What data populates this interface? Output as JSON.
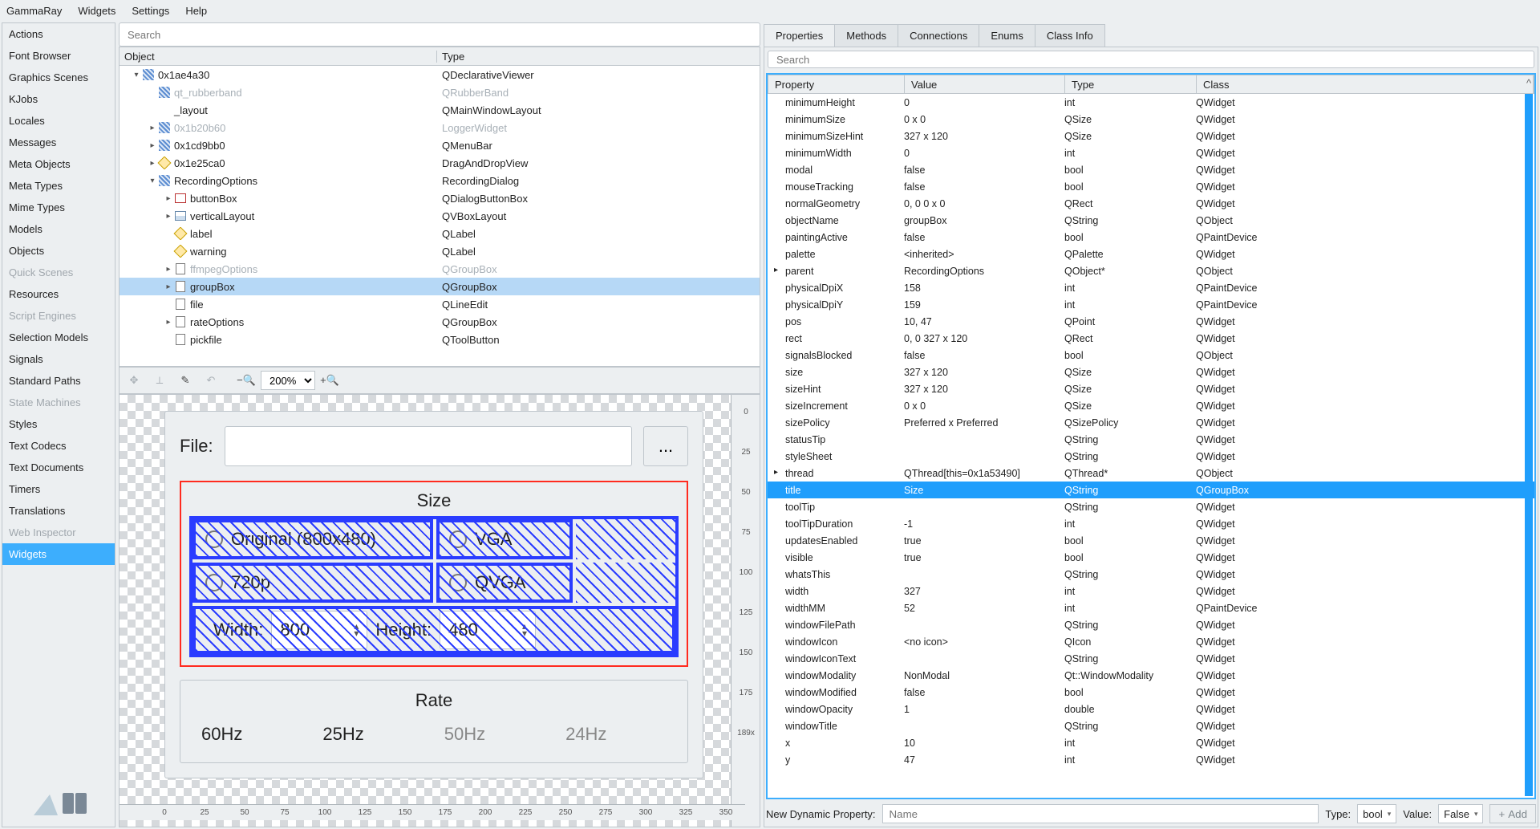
{
  "menubar": [
    "GammaRay",
    "Widgets",
    "Settings",
    "Help"
  ],
  "tool_list": [
    {
      "label": "Actions"
    },
    {
      "label": "Font Browser"
    },
    {
      "label": "Graphics Scenes"
    },
    {
      "label": "KJobs"
    },
    {
      "label": "Locales"
    },
    {
      "label": "Messages"
    },
    {
      "label": "Meta Objects"
    },
    {
      "label": "Meta Types"
    },
    {
      "label": "Mime Types"
    },
    {
      "label": "Models"
    },
    {
      "label": "Objects"
    },
    {
      "label": "Quick Scenes",
      "disabled": true
    },
    {
      "label": "Resources"
    },
    {
      "label": "Script Engines",
      "disabled": true
    },
    {
      "label": "Selection Models"
    },
    {
      "label": "Signals"
    },
    {
      "label": "Standard Paths"
    },
    {
      "label": "State Machines",
      "disabled": true
    },
    {
      "label": "Styles"
    },
    {
      "label": "Text Codecs"
    },
    {
      "label": "Text Documents"
    },
    {
      "label": "Timers"
    },
    {
      "label": "Translations"
    },
    {
      "label": "Web Inspector",
      "disabled": true
    },
    {
      "label": "Widgets",
      "selected": true
    }
  ],
  "obj_search_placeholder": "Search",
  "obj_headers": {
    "object": "Object",
    "type": "Type"
  },
  "obj_tree": [
    {
      "indent": 0,
      "twisty": "▾",
      "icon": "hatch",
      "name": "0x1ae4a30",
      "type": "QDeclarativeViewer"
    },
    {
      "indent": 1,
      "twisty": "",
      "icon": "hatch",
      "name": "qt_rubberband",
      "type": "QRubberBand",
      "disabled": true
    },
    {
      "indent": 1,
      "twisty": "",
      "icon": "",
      "name": "_layout",
      "type": "QMainWindowLayout"
    },
    {
      "indent": 1,
      "twisty": "▸",
      "icon": "hatch",
      "name": "0x1b20b60",
      "type": "LoggerWidget",
      "disabled": true
    },
    {
      "indent": 1,
      "twisty": "▸",
      "icon": "hatch",
      "name": "0x1cd9bb0",
      "type": "QMenuBar"
    },
    {
      "indent": 1,
      "twisty": "▸",
      "icon": "tag",
      "name": "0x1e25ca0",
      "type": "DragAndDropView"
    },
    {
      "indent": 1,
      "twisty": "▾",
      "icon": "hatch",
      "name": "RecordingOptions",
      "type": "RecordingDialog"
    },
    {
      "indent": 2,
      "twisty": "▸",
      "icon": "box",
      "name": "buttonBox",
      "type": "QDialogButtonBox"
    },
    {
      "indent": 2,
      "twisty": "▸",
      "icon": "layout",
      "name": "verticalLayout",
      "type": "QVBoxLayout"
    },
    {
      "indent": 2,
      "twisty": "",
      "icon": "tag",
      "name": "label",
      "type": "QLabel"
    },
    {
      "indent": 2,
      "twisty": "",
      "icon": "tag",
      "name": "warning",
      "type": "QLabel"
    },
    {
      "indent": 2,
      "twisty": "▸",
      "icon": "page",
      "name": "ffmpegOptions",
      "type": "QGroupBox",
      "disabled": true
    },
    {
      "indent": 2,
      "twisty": "▸",
      "icon": "page",
      "name": "groupBox",
      "type": "QGroupBox",
      "selected": true
    },
    {
      "indent": 2,
      "twisty": "",
      "icon": "page",
      "name": "file",
      "type": "QLineEdit"
    },
    {
      "indent": 2,
      "twisty": "▸",
      "icon": "page",
      "name": "rateOptions",
      "type": "QGroupBox"
    },
    {
      "indent": 2,
      "twisty": "",
      "icon": "page",
      "name": "pickfile",
      "type": "QToolButton"
    }
  ],
  "toolbar": {
    "zoom": "200%"
  },
  "preview": {
    "file_label": "File:",
    "browse": "...",
    "size_group": {
      "title": "Size",
      "opt_original": "Original (800x480)",
      "opt_vga": "VGA",
      "opt_720p": "720p",
      "opt_qvga": "QVGA",
      "width_label": "Width:",
      "height_label": "Height:",
      "width_val": "800",
      "height_val": "480"
    },
    "rate_group": {
      "title": "Rate",
      "opts": [
        "60Hz",
        "25Hz",
        "50Hz",
        "24Hz"
      ]
    },
    "ruler_x": [
      "0",
      "25",
      "50",
      "75",
      "100",
      "125",
      "150",
      "175",
      "200",
      "225",
      "250",
      "275",
      "300",
      "325",
      "350"
    ],
    "ruler_y": [
      "0",
      "25",
      "50",
      "75",
      "100",
      "125",
      "150",
      "175",
      "189x"
    ]
  },
  "right_tabs": [
    "Properties",
    "Methods",
    "Connections",
    "Enums",
    "Class Info"
  ],
  "prop_search_placeholder": "Search",
  "prop_headers": {
    "prop": "Property",
    "val": "Value",
    "type": "Type",
    "class": "Class"
  },
  "props": [
    {
      "p": "minimumHeight",
      "v": "0",
      "t": "int",
      "c": "QWidget"
    },
    {
      "p": "minimumSize",
      "v": "0 x 0",
      "t": "QSize",
      "c": "QWidget"
    },
    {
      "p": "minimumSizeHint",
      "v": "327 x 120",
      "t": "QSize",
      "c": "QWidget"
    },
    {
      "p": "minimumWidth",
      "v": "0",
      "t": "int",
      "c": "QWidget"
    },
    {
      "p": "modal",
      "v": "false",
      "t": "bool",
      "c": "QWidget"
    },
    {
      "p": "mouseTracking",
      "v": "false",
      "t": "bool",
      "c": "QWidget"
    },
    {
      "p": "normalGeometry",
      "v": "0, 0 0 x 0",
      "t": "QRect",
      "c": "QWidget"
    },
    {
      "p": "objectName",
      "v": "groupBox",
      "t": "QString",
      "c": "QObject"
    },
    {
      "p": "paintingActive",
      "v": "false",
      "t": "bool",
      "c": "QPaintDevice"
    },
    {
      "p": "palette",
      "v": "<inherited>",
      "t": "QPalette",
      "c": "QWidget"
    },
    {
      "p": "parent",
      "v": "RecordingOptions",
      "t": "QObject*",
      "c": "QObject",
      "expand": true
    },
    {
      "p": "physicalDpiX",
      "v": "158",
      "t": "int",
      "c": "QPaintDevice"
    },
    {
      "p": "physicalDpiY",
      "v": "159",
      "t": "int",
      "c": "QPaintDevice"
    },
    {
      "p": "pos",
      "v": "10, 47",
      "t": "QPoint",
      "c": "QWidget"
    },
    {
      "p": "rect",
      "v": "0, 0 327 x 120",
      "t": "QRect",
      "c": "QWidget"
    },
    {
      "p": "signalsBlocked",
      "v": "false",
      "t": "bool",
      "c": "QObject"
    },
    {
      "p": "size",
      "v": "327 x 120",
      "t": "QSize",
      "c": "QWidget"
    },
    {
      "p": "sizeHint",
      "v": "327 x 120",
      "t": "QSize",
      "c": "QWidget"
    },
    {
      "p": "sizeIncrement",
      "v": "0 x 0",
      "t": "QSize",
      "c": "QWidget"
    },
    {
      "p": "sizePolicy",
      "v": "Preferred x Preferred",
      "t": "QSizePolicy",
      "c": "QWidget"
    },
    {
      "p": "statusTip",
      "v": "",
      "t": "QString",
      "c": "QWidget"
    },
    {
      "p": "styleSheet",
      "v": "",
      "t": "QString",
      "c": "QWidget"
    },
    {
      "p": "thread",
      "v": "QThread[this=0x1a53490]",
      "t": "QThread*",
      "c": "QObject",
      "expand": true
    },
    {
      "p": "title",
      "v": "Size",
      "t": "QString",
      "c": "QGroupBox",
      "selected": true
    },
    {
      "p": "toolTip",
      "v": "",
      "t": "QString",
      "c": "QWidget"
    },
    {
      "p": "toolTipDuration",
      "v": "-1",
      "t": "int",
      "c": "QWidget"
    },
    {
      "p": "updatesEnabled",
      "v": "true",
      "t": "bool",
      "c": "QWidget"
    },
    {
      "p": "visible",
      "v": "true",
      "t": "bool",
      "c": "QWidget"
    },
    {
      "p": "whatsThis",
      "v": "",
      "t": "QString",
      "c": "QWidget"
    },
    {
      "p": "width",
      "v": "327",
      "t": "int",
      "c": "QWidget"
    },
    {
      "p": "widthMM",
      "v": "52",
      "t": "int",
      "c": "QPaintDevice"
    },
    {
      "p": "windowFilePath",
      "v": "",
      "t": "QString",
      "c": "QWidget"
    },
    {
      "p": "windowIcon",
      "v": "<no icon>",
      "t": "QIcon",
      "c": "QWidget"
    },
    {
      "p": "windowIconText",
      "v": "",
      "t": "QString",
      "c": "QWidget"
    },
    {
      "p": "windowModality",
      "v": "NonModal",
      "t": "Qt::WindowModality",
      "c": "QWidget"
    },
    {
      "p": "windowModified",
      "v": "false",
      "t": "bool",
      "c": "QWidget"
    },
    {
      "p": "windowOpacity",
      "v": "1",
      "t": "double",
      "c": "QWidget"
    },
    {
      "p": "windowTitle",
      "v": "",
      "t": "QString",
      "c": "QWidget"
    },
    {
      "p": "x",
      "v": "10",
      "t": "int",
      "c": "QWidget"
    },
    {
      "p": "y",
      "v": "47",
      "t": "int",
      "c": "QWidget"
    }
  ],
  "new_prop": {
    "label": "New Dynamic Property:",
    "name_placeholder": "Name",
    "type_label": "Type:",
    "type_value": "bool",
    "value_label": "Value:",
    "value_value": "False",
    "add": "Add"
  }
}
